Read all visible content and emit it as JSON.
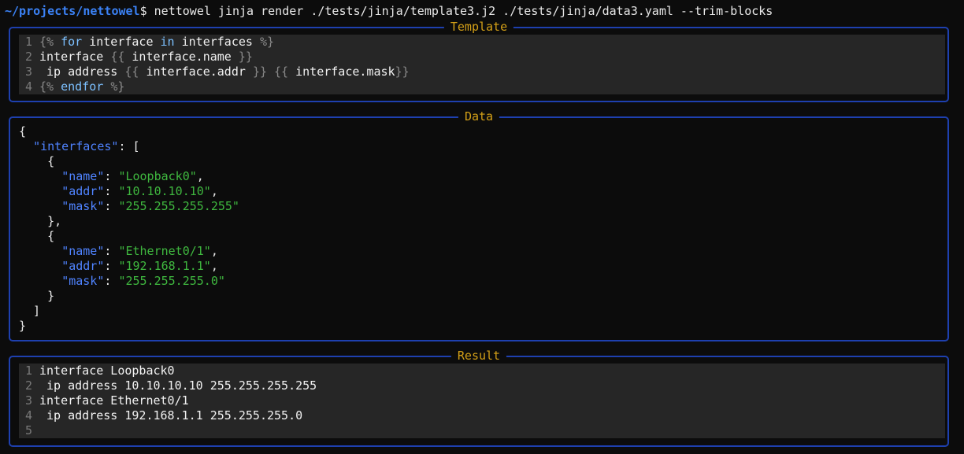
{
  "terminal": {
    "prompt_path": "~/projects/nettowel",
    "prompt_symbol": "$",
    "command": " nettowel jinja render ./tests/jinja/template3.j2 ./tests/jinja/data3.yaml --trim-blocks"
  },
  "template_panel": {
    "title": "Template",
    "lines": [
      {
        "no": "1",
        "parts": [
          [
            "delim",
            "{%"
          ],
          [
            "plain",
            " "
          ],
          [
            "kw",
            "for"
          ],
          [
            "plain",
            " interface "
          ],
          [
            "kw",
            "in"
          ],
          [
            "plain",
            " interfaces "
          ],
          [
            "delim",
            "%}"
          ]
        ]
      },
      {
        "no": "2",
        "parts": [
          [
            "plain",
            "interface "
          ],
          [
            "delim",
            "{{"
          ],
          [
            "plain",
            " interface.name "
          ],
          [
            "delim",
            "}}"
          ]
        ]
      },
      {
        "no": "3",
        "parts": [
          [
            "plain",
            " ip address "
          ],
          [
            "delim",
            "{{"
          ],
          [
            "plain",
            " interface.addr "
          ],
          [
            "delim",
            "}}"
          ],
          [
            "plain",
            " "
          ],
          [
            "delim",
            "{{"
          ],
          [
            "plain",
            " interface.mask"
          ],
          [
            "delim",
            "}}"
          ]
        ]
      },
      {
        "no": "4",
        "parts": [
          [
            "delim",
            "{%"
          ],
          [
            "plain",
            " "
          ],
          [
            "kw",
            "endfor"
          ],
          [
            "plain",
            " "
          ],
          [
            "delim",
            "%}"
          ]
        ]
      }
    ]
  },
  "data_panel": {
    "title": "Data",
    "lines": [
      [
        [
          "punct",
          "{"
        ]
      ],
      [
        [
          "punct",
          "  "
        ],
        [
          "key",
          "\"interfaces\""
        ],
        [
          "punct",
          ": ["
        ]
      ],
      [
        [
          "punct",
          "    {"
        ]
      ],
      [
        [
          "punct",
          "      "
        ],
        [
          "key",
          "\"name\""
        ],
        [
          "punct",
          ": "
        ],
        [
          "str",
          "\"Loopback0\""
        ],
        [
          "punct",
          ","
        ]
      ],
      [
        [
          "punct",
          "      "
        ],
        [
          "key",
          "\"addr\""
        ],
        [
          "punct",
          ": "
        ],
        [
          "str",
          "\"10.10.10.10\""
        ],
        [
          "punct",
          ","
        ]
      ],
      [
        [
          "punct",
          "      "
        ],
        [
          "key",
          "\"mask\""
        ],
        [
          "punct",
          ": "
        ],
        [
          "str",
          "\"255.255.255.255\""
        ]
      ],
      [
        [
          "punct",
          "    },"
        ]
      ],
      [
        [
          "punct",
          "    {"
        ]
      ],
      [
        [
          "punct",
          "      "
        ],
        [
          "key",
          "\"name\""
        ],
        [
          "punct",
          ": "
        ],
        [
          "str",
          "\"Ethernet0/1\""
        ],
        [
          "punct",
          ","
        ]
      ],
      [
        [
          "punct",
          "      "
        ],
        [
          "key",
          "\"addr\""
        ],
        [
          "punct",
          ": "
        ],
        [
          "str",
          "\"192.168.1.1\""
        ],
        [
          "punct",
          ","
        ]
      ],
      [
        [
          "punct",
          "      "
        ],
        [
          "key",
          "\"mask\""
        ],
        [
          "punct",
          ": "
        ],
        [
          "str",
          "\"255.255.255.0\""
        ]
      ],
      [
        [
          "punct",
          "    }"
        ]
      ],
      [
        [
          "punct",
          "  ]"
        ]
      ],
      [
        [
          "punct",
          "}"
        ]
      ]
    ]
  },
  "result_panel": {
    "title": "Result",
    "lines": [
      {
        "no": "1",
        "text": "interface Loopback0"
      },
      {
        "no": "2",
        "text": " ip address 10.10.10.10 255.255.255.255"
      },
      {
        "no": "3",
        "text": "interface Ethernet0/1"
      },
      {
        "no": "4",
        "text": " ip address 192.168.1.1 255.255.255.0"
      },
      {
        "no": "5",
        "text": ""
      }
    ]
  },
  "colors": {
    "background": "#0c0c0c",
    "panel_border": "#1e40af",
    "panel_title": "#d4a017",
    "code_bg": "#262626",
    "json_key": "#4f83ff",
    "json_string": "#3fb83f",
    "jinja_keyword": "#7cc0ff",
    "prompt_path": "#3b82f6"
  }
}
